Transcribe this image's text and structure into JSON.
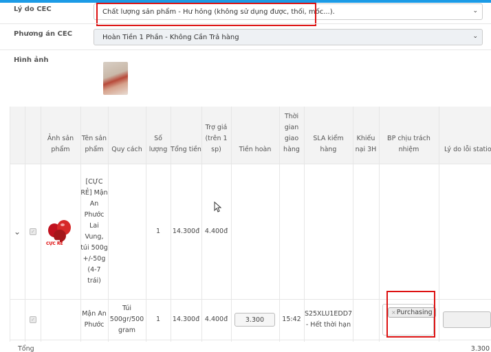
{
  "form": {
    "reason_label": "Lý do CEC",
    "reason_value": "Chất lượng sản phẩm - Hư hỏng (không sử dụng được, thối, mốc...).",
    "plan_label": "Phương án CEC",
    "plan_value": "Hoàn Tiền 1 Phần - Không Cần Trả hàng",
    "image_label": "Hình ảnh"
  },
  "table": {
    "headers": {
      "image": "Ảnh sản phẩm",
      "name": "Tên sản phẩm",
      "spec": "Quy cách",
      "qty": "Số lượng",
      "total": "Tổng tiền",
      "subsidy": "Trợ giá (trên 1 sp)",
      "refund": "Tiền hoàn",
      "delivery_time": "Thời gian giao hàng",
      "sla": "SLA kiểm hàng",
      "complaint": "Khiếu nại 3H",
      "dept": "BP chịu trách nhiệm",
      "station_reason": "Lý do lỗi station"
    },
    "parent_row": {
      "name": "[CỰC RẺ] Mận An Phước Lai Vung, túi 500g +/-50g (4-7 trái)",
      "qty": "1",
      "total": "14.300đ",
      "subsidy": "4.400đ",
      "img_badge": "CỰC RẺ"
    },
    "child_row": {
      "name": "Mận An Phước",
      "spec": "Túi 500gr/500 gram",
      "qty": "1",
      "total": "14.300đ",
      "subsidy": "4.400đ",
      "refund": "3.300",
      "delivery_time": "15:42",
      "sla": "S25XLU1EDD7 - Hết thời hạn",
      "dept_tag": "Purchasing"
    },
    "footer": {
      "total_label": "Tổng",
      "total_value": "3.300"
    }
  }
}
